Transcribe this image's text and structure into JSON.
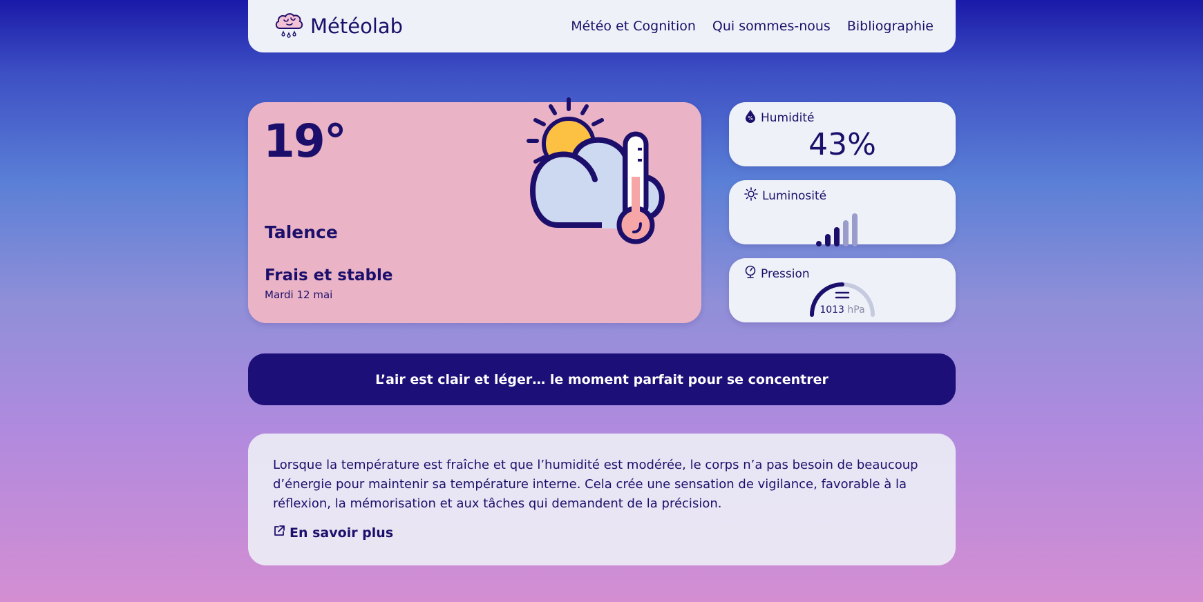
{
  "nav": {
    "brand": "Météolab",
    "links": [
      "Météo et Cognition",
      "Qui sommes-nous",
      "Bibliographie"
    ]
  },
  "weather": {
    "temperature": "19°",
    "city": "Talence",
    "condition": "Frais et stable",
    "date": "Mardi 12 mai"
  },
  "stats": {
    "humidity": {
      "label": "Humidité",
      "value": "43%"
    },
    "luminosity": {
      "label": "Luminosité",
      "level": 3,
      "max": 5
    },
    "pressure": {
      "label": "Pression",
      "value": "1013",
      "unit": "hPa"
    }
  },
  "banner": {
    "text": "L’air est clair et léger… le moment parfait pour se concentrer"
  },
  "info": {
    "text": "Lorsque la température est fraîche et que l’humidité est modérée, le corps n’a pas besoin de beaucoup d’énergie pour maintenir sa température interne. Cela crée une sensation de vigilance, favorable à la réflexion, la mémorisation et aux tâches qui demandent de la précision.",
    "link": "En savoir plus"
  },
  "colors": {
    "primary": "#1c0f6b",
    "card": "#eef1f7",
    "weather_card": "#ebb4c6",
    "banner": "#1c0f78",
    "sun": "#fcc043",
    "cloud": "#cdd9f1"
  }
}
